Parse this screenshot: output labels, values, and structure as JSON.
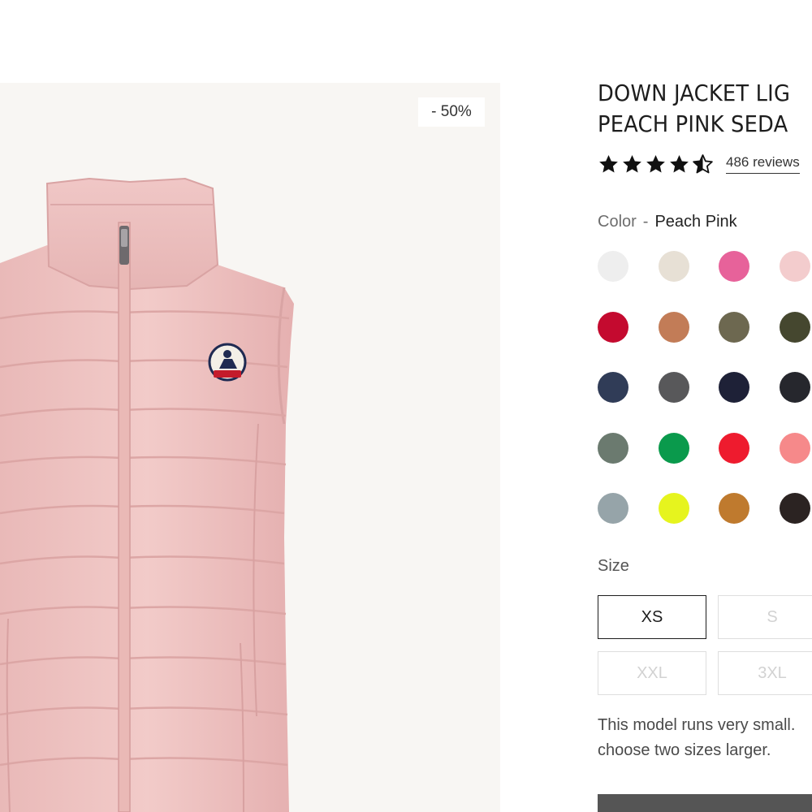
{
  "product": {
    "discount_badge": "- 50%",
    "title_line1": "DOWN JACKET LIG",
    "title_line2": "PEACH PINK SEDA",
    "rating": 4.5,
    "reviews_label": "486 reviews"
  },
  "color": {
    "label": "Color",
    "separator": "-",
    "selected": "Peach Pink",
    "swatches": [
      {
        "name": "light-grey",
        "hex": "#eeeeee"
      },
      {
        "name": "beige",
        "hex": "#e7e0d5"
      },
      {
        "name": "pink",
        "hex": "#e7629a"
      },
      {
        "name": "peach-pink",
        "hex": "#f3cccd"
      },
      {
        "name": "red",
        "hex": "#c40a2f"
      },
      {
        "name": "camel",
        "hex": "#c27c57"
      },
      {
        "name": "khaki",
        "hex": "#6d6850"
      },
      {
        "name": "olive",
        "hex": "#45472f"
      },
      {
        "name": "navy",
        "hex": "#303c57"
      },
      {
        "name": "charcoal",
        "hex": "#58585a"
      },
      {
        "name": "dark-navy",
        "hex": "#1e2137"
      },
      {
        "name": "black",
        "hex": "#26272d"
      },
      {
        "name": "sage",
        "hex": "#6b7a6f"
      },
      {
        "name": "green",
        "hex": "#0a9a4c"
      },
      {
        "name": "bright-red",
        "hex": "#ee1b2e"
      },
      {
        "name": "coral",
        "hex": "#f6898a"
      },
      {
        "name": "grey-blue",
        "hex": "#96a4a9"
      },
      {
        "name": "lime",
        "hex": "#e6f41e"
      },
      {
        "name": "cognac",
        "hex": "#bf7a2e"
      },
      {
        "name": "dark-brown",
        "hex": "#2b2322"
      }
    ]
  },
  "size": {
    "label": "Size",
    "options": [
      {
        "label": "XS",
        "selected": true
      },
      {
        "label": "S",
        "selected": false
      },
      {
        "label": "XXL",
        "selected": false
      },
      {
        "label": "3XL",
        "selected": false
      }
    ]
  },
  "fit_note_line1": "This model runs very small.",
  "fit_note_line2": "choose two sizes larger."
}
